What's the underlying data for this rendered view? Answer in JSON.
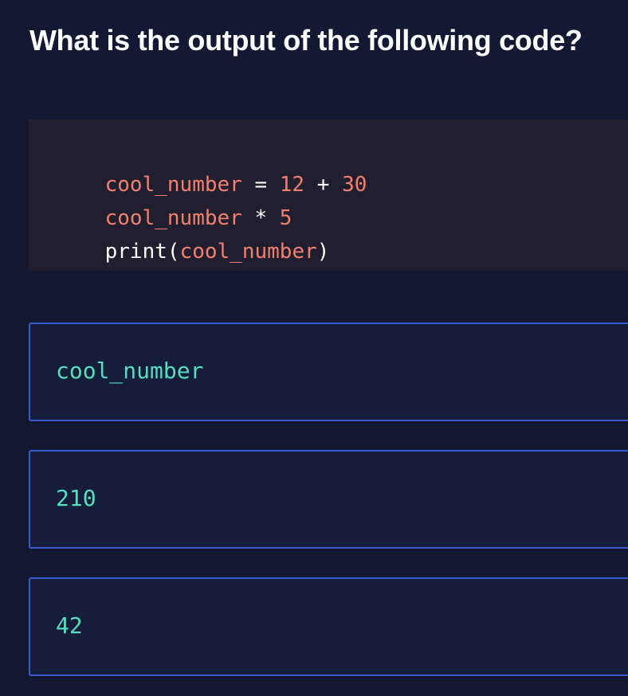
{
  "question": {
    "title": "What is the output of the following code?"
  },
  "code": {
    "lines": [
      {
        "tokens": [
          {
            "text": "cool_number",
            "kind": "var"
          },
          {
            "text": " = ",
            "kind": "op"
          },
          {
            "text": "12",
            "kind": "num"
          },
          {
            "text": " + ",
            "kind": "op"
          },
          {
            "text": "30",
            "kind": "num"
          }
        ]
      },
      {
        "tokens": [
          {
            "text": "cool_number",
            "kind": "var"
          },
          {
            "text": " * ",
            "kind": "op"
          },
          {
            "text": "5",
            "kind": "num"
          }
        ]
      },
      {
        "tokens": [
          {
            "text": "print",
            "kind": "fn"
          },
          {
            "text": "(",
            "kind": "punct"
          },
          {
            "text": "cool_number",
            "kind": "var"
          },
          {
            "text": ")",
            "kind": "punct"
          }
        ]
      }
    ]
  },
  "options": [
    {
      "label": "cool_number"
    },
    {
      "label": "210"
    },
    {
      "label": "42"
    }
  ],
  "colors": {
    "background": "#131932",
    "code_background": "#211f2f",
    "code_token": "#f2806c",
    "option_background": "#151d3b",
    "option_border": "#3a5bd0",
    "option_text": "#55dfbf"
  }
}
